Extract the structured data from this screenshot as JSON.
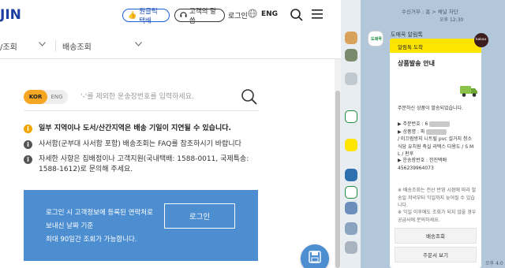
{
  "header": {
    "logo": "JIN",
    "clean_label": "원클릭 택배",
    "voice_label": "고객의 말씀",
    "login_label": "로그인",
    "lang_label": "ENG"
  },
  "subnav": {
    "item1": "/조회",
    "item2": "배송조회"
  },
  "search": {
    "lang_kor": "KOR",
    "lang_eng": "ENG",
    "placeholder": "'-'를 제외한 운송장번호를 입력하세요."
  },
  "notices": [
    "일부 지역이나 도서/산간지역은 배송 기일이 지연될 수 있습니다.",
    "사서함(군부대 사서함 포함) 배송조회는 FAQ를 참조하시기 바랍니다",
    "자세한 사항은 집배점이나 고객지원(국내택배: 1588-0011, 국제특송: 1588-1612)로 문의해 주세요."
  ],
  "login_box": {
    "line1": "로그인 시 고객정보에 등록된 연락처로",
    "line2": "보내신 날짜 기준",
    "line3": "최대 90일간 조회가 가능합니다.",
    "button": "로그인"
  },
  "chat": {
    "meta_top": "수신거부 : 홈 > 채널 차단",
    "meta_time": "오후 12:30",
    "bot_name": "도매꾹 알림톡",
    "bot_avatar_text": "도매꾹",
    "banner": "알림톡 도착",
    "badge": "kakao",
    "title": "상품발송 안내",
    "body1": "주문하신 상품이 발송되었습니다.",
    "body2_a": "▶ 주문번호 : 6",
    "body2_b": "▶ 상품명 : 파",
    "body2_c": "/ 미끄럼방지 니트릴 pvc 설거지 청소 식당 유치원 축실 라텍스 다용도 / S M L / 판후",
    "body3": "▶ 운송장번호 : 한진택배 456239964073",
    "body4": "※ 배송조회는 전산 반영 시점에 따라 발송일 저녁부터 익일까지 늦어질 수 있습니다.",
    "body5": "※ 익일 이후에도 조회가 되지 않을 경우 공급사에 문의하세요.",
    "btn1": "배송조회",
    "btn2": "주문서 보기",
    "right_time": "오후 4:0"
  },
  "colors": {
    "brand_blue": "#1d3fa0",
    "login_panel": "#4d8ed1",
    "toggle_active": "#f5a623",
    "kakao_yellow": "#fee500",
    "chat_bg": "#b2c7da"
  }
}
